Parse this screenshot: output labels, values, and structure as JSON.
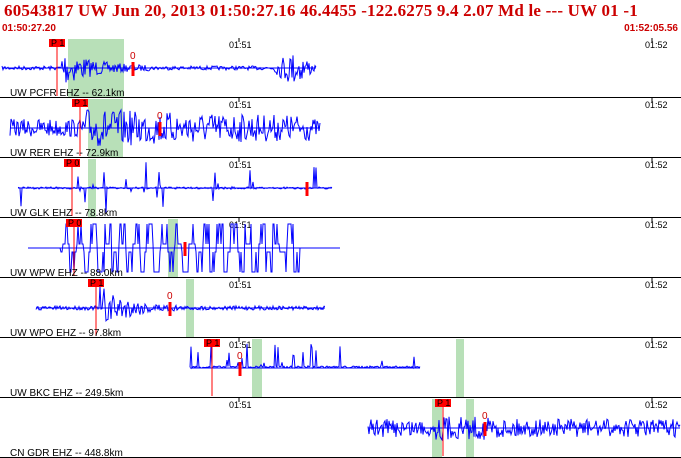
{
  "header": {
    "title": "60543817 UW Jun 20, 2013 01:50:27.16   46.4455 -122.6275  9.4 2.07 Md le --- UW 01  -1",
    "start_time": "01:50:27.20",
    "end_time": "01:52:05.56"
  },
  "colors": {
    "trace": "#0000ff",
    "pick": "#ff0000",
    "window": "#b8e0b8",
    "header": "#cc0000"
  },
  "axis": {
    "tick_left": "01:51",
    "tick_right": "01:52"
  },
  "traces": [
    {
      "label": "UW PCFR EHZ -- 62.1km",
      "pick": "P 1",
      "s_mark": "0"
    },
    {
      "label": "UW RER EHZ -- 72.9km",
      "pick": "P 1",
      "s_mark": "0"
    },
    {
      "label": "UW GLK EHZ -- 78.8km",
      "pick": "P 0",
      "s_mark": ""
    },
    {
      "label": "UW WPW EHZ -- 88.0km",
      "pick": "P 0",
      "s_mark": ""
    },
    {
      "label": "UW WPO EHZ -- 97.8km",
      "pick": "P 1",
      "s_mark": "0"
    },
    {
      "label": "UW BKC EHZ -- 249.5km",
      "pick": "P 1",
      "s_mark": "0"
    },
    {
      "label": "CN GDR EHZ -- 448.8km",
      "pick": "P 1",
      "s_mark": "0"
    }
  ]
}
